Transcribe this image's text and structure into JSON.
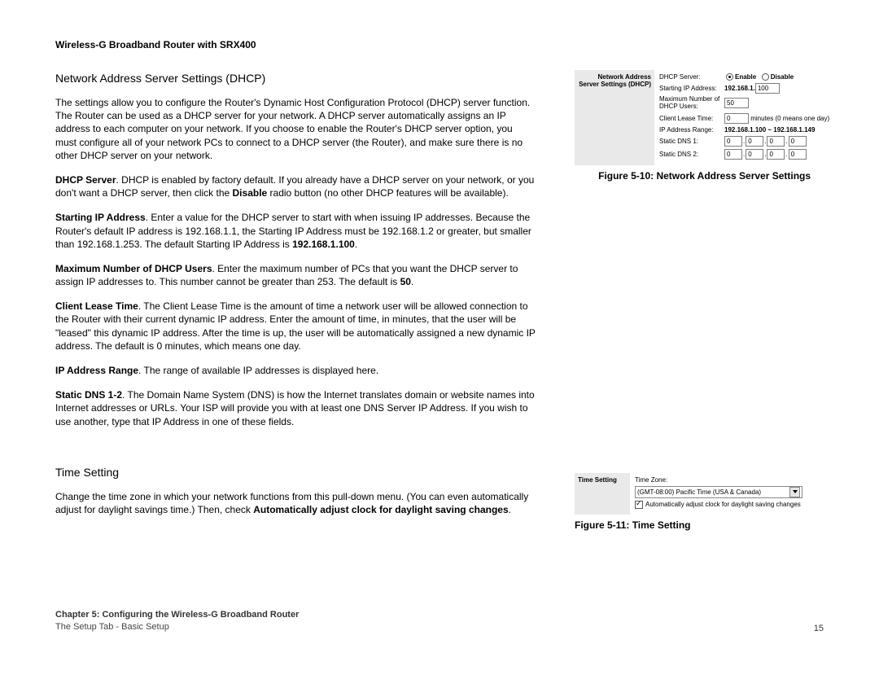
{
  "header": "Wireless-G Broadband Router with SRX400",
  "section1": {
    "title": "Network Address Server Settings (DHCP)",
    "intro": "The settings allow you to configure the Router's Dynamic Host Configuration Protocol (DHCP) server function. The Router can be used as a DHCP server for your network. A DHCP server automatically assigns an IP address to each computer on your network. If you choose to enable the Router's DHCP server option, you must configure all of your network PCs to connect to a DHCP server (the Router), and make sure there is no other DHCP server on your network.",
    "p_dhcp_bold": "DHCP Server",
    "p_dhcp_a": ". DHCP is enabled by factory default. If you already have a DHCP server on your network, or you don't want a DHCP server, then click the ",
    "p_dhcp_disable": "Disable",
    "p_dhcp_b": " radio button (no other DHCP features will be available).",
    "p_start_bold": "Starting IP Address",
    "p_start_a": ". Enter a value for the DHCP server to start with when issuing IP addresses.  Because the Router's default IP address is 192.168.1.1, the Starting IP Address must be 192.168.1.2 or greater, but smaller than 192.168.1.253. The default Starting IP Address is ",
    "p_start_def": "192.168.1.100",
    "p_start_c": ".",
    "p_max_bold": "Maximum Number of DHCP Users",
    "p_max_a": ". Enter the maximum number of PCs that you want the DHCP server to assign IP addresses to. This number cannot be greater than 253. The default is ",
    "p_max_def": "50",
    "p_max_c": ".",
    "p_lease_bold": "Client Lease Time",
    "p_lease_a": ". The Client Lease Time is the amount of time a network user will be allowed connection to the Router with their current dynamic IP address. Enter the amount of time, in minutes, that the user will be \"leased\" this dynamic IP address. After the time is up, the user will be automatically assigned a new dynamic IP address. The default is 0 minutes, which means one day.",
    "p_range_bold": "IP Address Range",
    "p_range_a": ". The range of available IP addresses is displayed here.",
    "p_dns_bold": "Static DNS 1-2",
    "p_dns_a": ". The Domain Name System (DNS) is how the Internet translates domain or website names into Internet addresses or URLs. Your ISP will provide you with at least one DNS Server IP Address. If you wish to use another, type that IP Address in one of these fields."
  },
  "section2": {
    "title": "Time Setting",
    "p_a": "Change the time zone in which your network functions from this pull-down menu. (You can even automatically adjust for daylight savings time.) Then, check ",
    "p_bold": "Automatically adjust clock for daylight saving changes",
    "p_c": "."
  },
  "fig1": {
    "caption": "Figure 5-10: Network Address Server Settings",
    "panel_label1": "Network Address",
    "panel_label2": "Server Settings (DHCP)",
    "rows": {
      "dhcp_server": "DHCP Server:",
      "enable": "Enable",
      "disable": "Disable",
      "start_ip": "Starting IP Address:",
      "start_ip_prefix": "192.168.1.",
      "start_ip_val": "100",
      "max_users_l1": "Maximum Number of",
      "max_users_l2": "DHCP Users:",
      "max_users_val": "50",
      "lease": "Client Lease Time:",
      "lease_val": "0",
      "lease_suffix": "minutes (0 means one day)",
      "range": "IP Address Range:",
      "range_val": "192.168.1.100 ~ 192.168.1.149",
      "dns1": "Static DNS 1:",
      "dns2": "Static DNS 2:",
      "zero": "0"
    }
  },
  "fig2": {
    "caption": "Figure 5-11: Time Setting",
    "panel_label": "Time Setting",
    "rows": {
      "tz": "Time Zone:",
      "tz_val": "(GMT-08:00) Pacific Time (USA & Canada)",
      "auto": "Automatically adjust clock for daylight saving changes"
    }
  },
  "footer": {
    "chapter": "Chapter 5: Configuring the Wireless-G Broadband Router",
    "subtitle": "The Setup Tab - Basic Setup",
    "page": "15"
  }
}
